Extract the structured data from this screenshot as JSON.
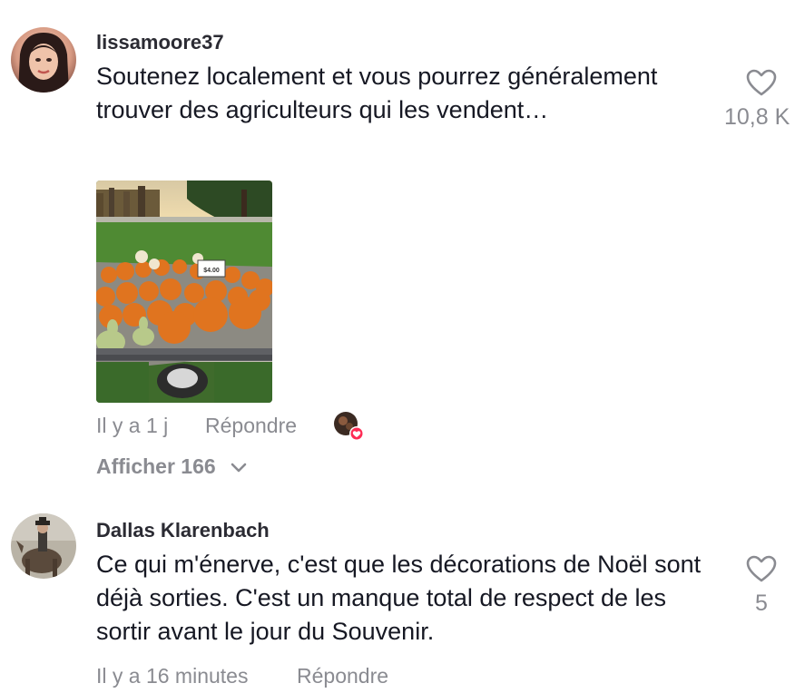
{
  "comments": [
    {
      "username": "lissamoore37",
      "text": "Soutenez localement et vous pourrez généralement trouver des agriculteurs qui les vendent…",
      "like_count": "10,8 K",
      "time": "Il y a 1 j",
      "reply_label": "Répondre",
      "view_more_label": "Afficher 166"
    },
    {
      "username": "Dallas Klarenbach",
      "text": "Ce qui m'énerve, c'est que les décorations de Noël sont déjà sorties. C'est un manque total de respect de les sortir avant le jour du Souvenir.",
      "like_count": "5",
      "time": "Il y a 16 minutes",
      "reply_label": "Répondre"
    }
  ],
  "photo": {
    "price_sign": "$4.00"
  },
  "colors": {
    "muted": "#8a8b91",
    "text": "#161823",
    "heart_badge": "#fe2c55"
  }
}
